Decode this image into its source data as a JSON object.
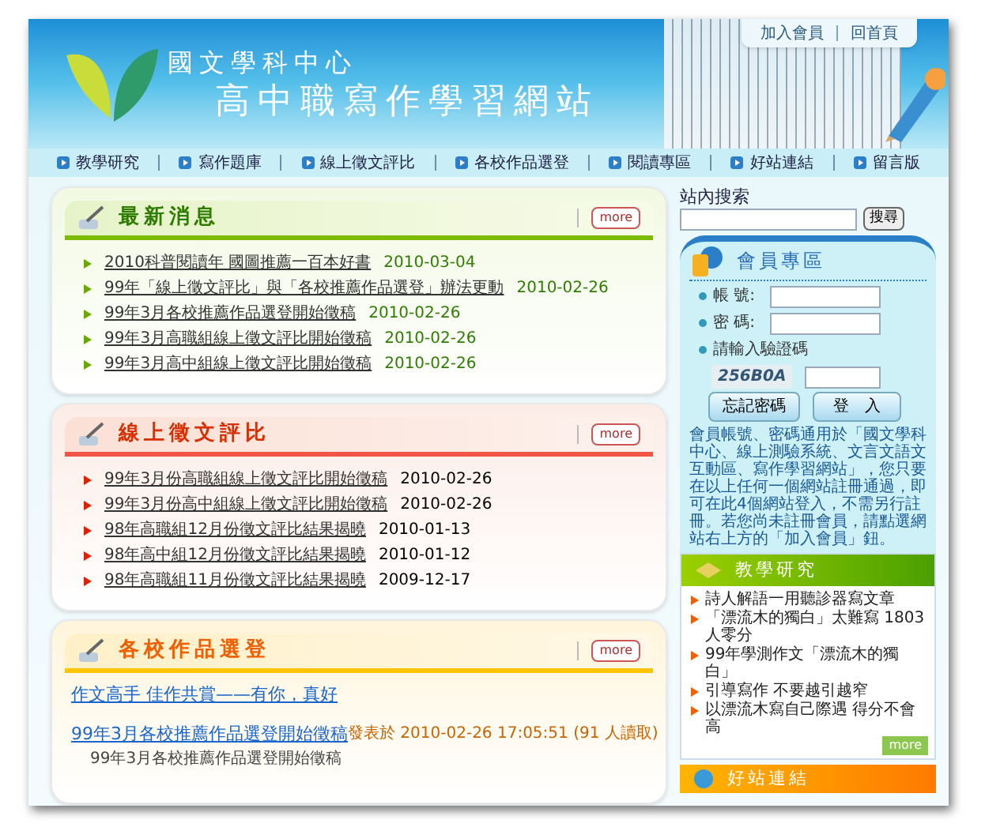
{
  "header": {
    "org": "國文學科中心",
    "site": "高中職寫作學習網站",
    "top_links": [
      "加入會員",
      "回首頁"
    ]
  },
  "nav": [
    "教學研究",
    "寫作題庫",
    "線上徵文評比",
    "各校作品選登",
    "閱讀專區",
    "好站連結",
    "留言版"
  ],
  "news": {
    "title": "最新消息",
    "more": "more",
    "items": [
      {
        "title": "2010科普閱讀年 國圖推薦一百本好書",
        "date": "2010-03-04"
      },
      {
        "title": "99年「線上徵文評比」與「各校推薦作品選登」辦法更動",
        "date": "2010-02-26"
      },
      {
        "title": "99年3月各校推薦作品選登開始徵稿",
        "date": "2010-02-26"
      },
      {
        "title": "99年3月高職組線上徵文評比開始徵稿",
        "date": "2010-02-26"
      },
      {
        "title": "99年3月高中組線上徵文評比開始徵稿",
        "date": "2010-02-26"
      }
    ]
  },
  "contest": {
    "title": "線上徵文評比",
    "more": "more",
    "items": [
      {
        "title": "99年3月份高職組線上徵文評比開始徵稿",
        "date": "2010-02-26"
      },
      {
        "title": "99年3月份高中組線上徵文評比開始徵稿",
        "date": "2010-02-26"
      },
      {
        "title": "98年高職組12月份徵文評比結果揭曉",
        "date": "2010-01-13"
      },
      {
        "title": "98年高中組12月份徵文評比結果揭曉",
        "date": "2010-01-12"
      },
      {
        "title": "98年高職組11月份徵文評比結果揭曉",
        "date": "2009-12-17"
      }
    ]
  },
  "works": {
    "title": "各校作品選登",
    "more": "more",
    "featured": "作文高手 佳作共賞——有你，真好",
    "posts": [
      {
        "title": "99年3月各校推薦作品選登開始徵稿",
        "meta": "發表於 2010-02-26 17:05:51 (91 人讀取)",
        "summary": "99年3月各校推薦作品選登開始徵稿"
      }
    ]
  },
  "sidebar": {
    "search": {
      "label": "站內搜索",
      "button": "搜尋"
    },
    "member": {
      "title": "會員專區",
      "account_label": "帳 號:",
      "password_label": "密 碼:",
      "captcha_label": "請輸入驗證碼",
      "captcha": "256B0A",
      "forgot": "忘記密碼",
      "login": "登　入",
      "note": "會員帳號、密碼通用於「國文學科中心、線上測驗系統、文言文語文互動區、寫作學習網站」，您只要在以上任何一個網站註冊通過，即可在此4個網站登入，不需另行註冊。若您尚未註冊會員，請點選網站右上方的「加入會員」鈕。"
    },
    "research": {
      "title": "教學研究",
      "more": "more",
      "items": [
        "詩人解語一用聽診器寫文章",
        "「漂流木的獨白」太難寫 1803人零分",
        "99年學測作文「漂流木的獨白」",
        "引導寫作 不要越引越窄",
        "以漂流木寫自己際遇 得分不會高"
      ]
    },
    "links": {
      "title": "好站連結"
    }
  }
}
